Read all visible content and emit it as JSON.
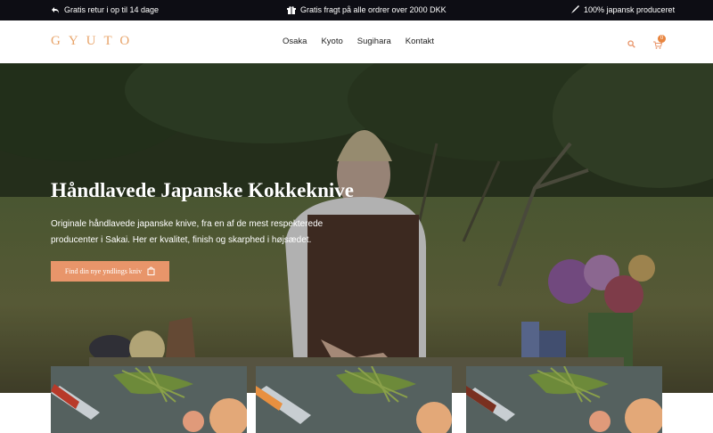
{
  "topbar": {
    "items": [
      {
        "icon": "return-icon",
        "text": "Gratis retur i op til 14 dage"
      },
      {
        "icon": "gift-icon",
        "text": "Gratis fragt på alle ordrer over 2000 DKK"
      },
      {
        "icon": "knife-icon",
        "text": "100% japansk produceret"
      }
    ]
  },
  "header": {
    "logo": "GYUTO",
    "nav": [
      "Osaka",
      "Kyoto",
      "Sugihara",
      "Kontakt"
    ],
    "cart_count": "0",
    "icons": {
      "search": "search-icon",
      "cart": "cart-icon"
    }
  },
  "hero": {
    "title": "Håndlavede Japanske Kokkeknive",
    "subtitle": "Originale håndlavede japanske knive, fra en af de mest respekterede producenter i Sakai. Her er kvalitet, finish og skarphed i højsædet.",
    "button_label": "Find din nye yndlings kniv"
  },
  "colors": {
    "accent": "#e8956a",
    "topbar_bg": "#0d0d14",
    "logo": "#e8a46a"
  }
}
